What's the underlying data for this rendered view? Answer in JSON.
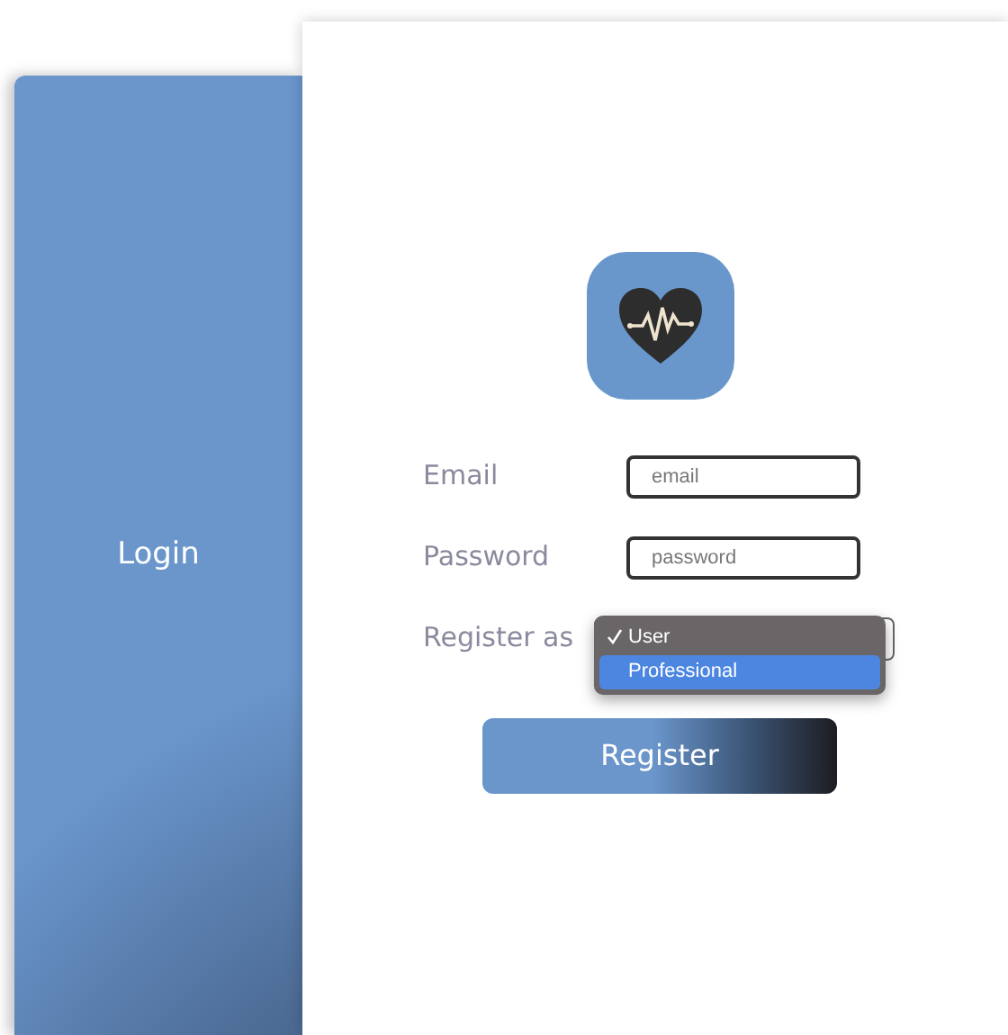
{
  "side_panel": {
    "label": "Login"
  },
  "form": {
    "fields": [
      {
        "label": "Email",
        "placeholder": "email"
      },
      {
        "label": "Password",
        "placeholder": "password"
      }
    ],
    "register_as": {
      "label": "Register as",
      "open": true,
      "options": [
        {
          "label": "User",
          "checked": true,
          "highlighted": false
        },
        {
          "label": "Professional",
          "checked": false,
          "highlighted": true
        }
      ]
    },
    "submit": "Register"
  }
}
